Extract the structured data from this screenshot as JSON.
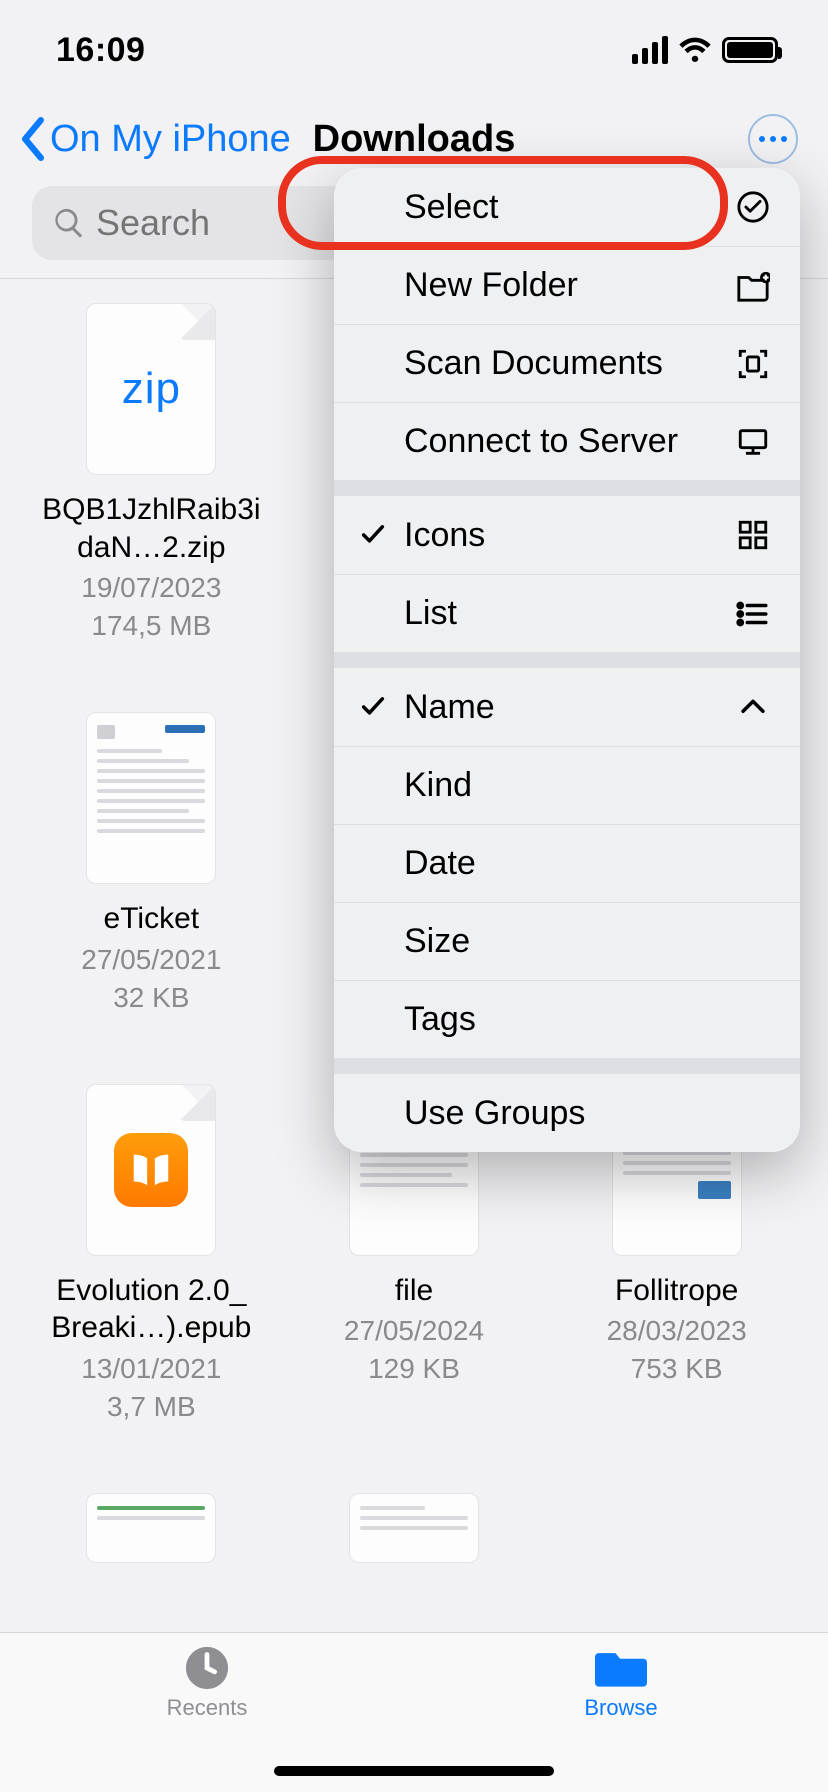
{
  "status": {
    "time": "16:09"
  },
  "nav": {
    "back_label": "On My iPhone",
    "title": "Downloads"
  },
  "search": {
    "placeholder": "Search"
  },
  "menu": {
    "select": "Select",
    "new_folder": "New Folder",
    "scan_docs": "Scan Documents",
    "connect_server": "Connect to Server",
    "view_icons": "Icons",
    "view_list": "List",
    "sort_name": "Name",
    "sort_kind": "Kind",
    "sort_date": "Date",
    "sort_size": "Size",
    "sort_tags": "Tags",
    "use_groups": "Use Groups"
  },
  "files": [
    {
      "name": "BQB1JzhlRaib3idaN…2.zip",
      "date": "19/07/2023",
      "size": "174,5 MB",
      "kind": "zip"
    },
    {
      "name": "eTicket",
      "date": "27/05/2021",
      "size": "32 KB",
      "kind": "pdf"
    },
    {
      "name": "Evolution 2.0_ Breaki…).epub",
      "date": "13/01/2021",
      "size": "3,7 MB",
      "kind": "epub"
    },
    {
      "name": "file",
      "date": "27/05/2024",
      "size": "129 KB",
      "kind": "pdf"
    },
    {
      "name": "Follitrope",
      "date": "28/03/2023",
      "size": "753 KB",
      "kind": "pdf"
    }
  ],
  "tabs": {
    "recents": "Recents",
    "browse": "Browse"
  }
}
